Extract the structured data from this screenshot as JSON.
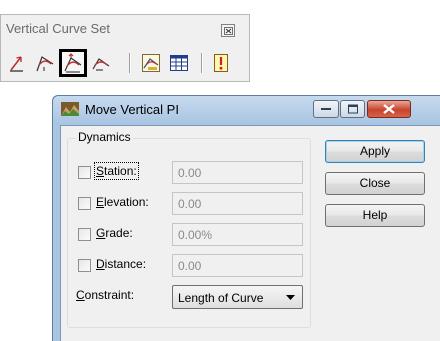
{
  "toolbox": {
    "title": "Vertical Curve Set",
    "tools": [
      {
        "icon": "place-vertical-pi-icon"
      },
      {
        "icon": "insert-vertical-pi-icon"
      },
      {
        "icon": "move-vertical-pi-icon",
        "selected": true
      },
      {
        "icon": "delete-vertical-pi-icon"
      },
      {
        "icon": "vertical-curve-editor-icon"
      },
      {
        "icon": "vertical-table-icon"
      },
      {
        "icon": "tips-icon"
      }
    ]
  },
  "dialog": {
    "title": "Move Vertical PI",
    "group": {
      "label": "Dynamics",
      "rows": [
        {
          "label_access": "S",
          "label_rest": "tation:",
          "value": "0.00",
          "checked": false
        },
        {
          "label_access": "E",
          "label_rest": "levation:",
          "value": "0.00",
          "checked": false
        },
        {
          "label_access": "G",
          "label_rest": "rade:",
          "value": "0.00%",
          "checked": false
        },
        {
          "label_access": "D",
          "label_rest": "istance:",
          "value": "0.00",
          "checked": false
        }
      ],
      "constraint": {
        "label_access": "C",
        "label_rest": "onstraint:",
        "selected": "Length of Curve"
      }
    },
    "buttons": {
      "apply": "Apply",
      "close": "Close",
      "help": "Help"
    }
  },
  "colors": {
    "title_bar": "#a9c5e2",
    "close_caption": "#c7442c",
    "selection_border": "#000000"
  }
}
